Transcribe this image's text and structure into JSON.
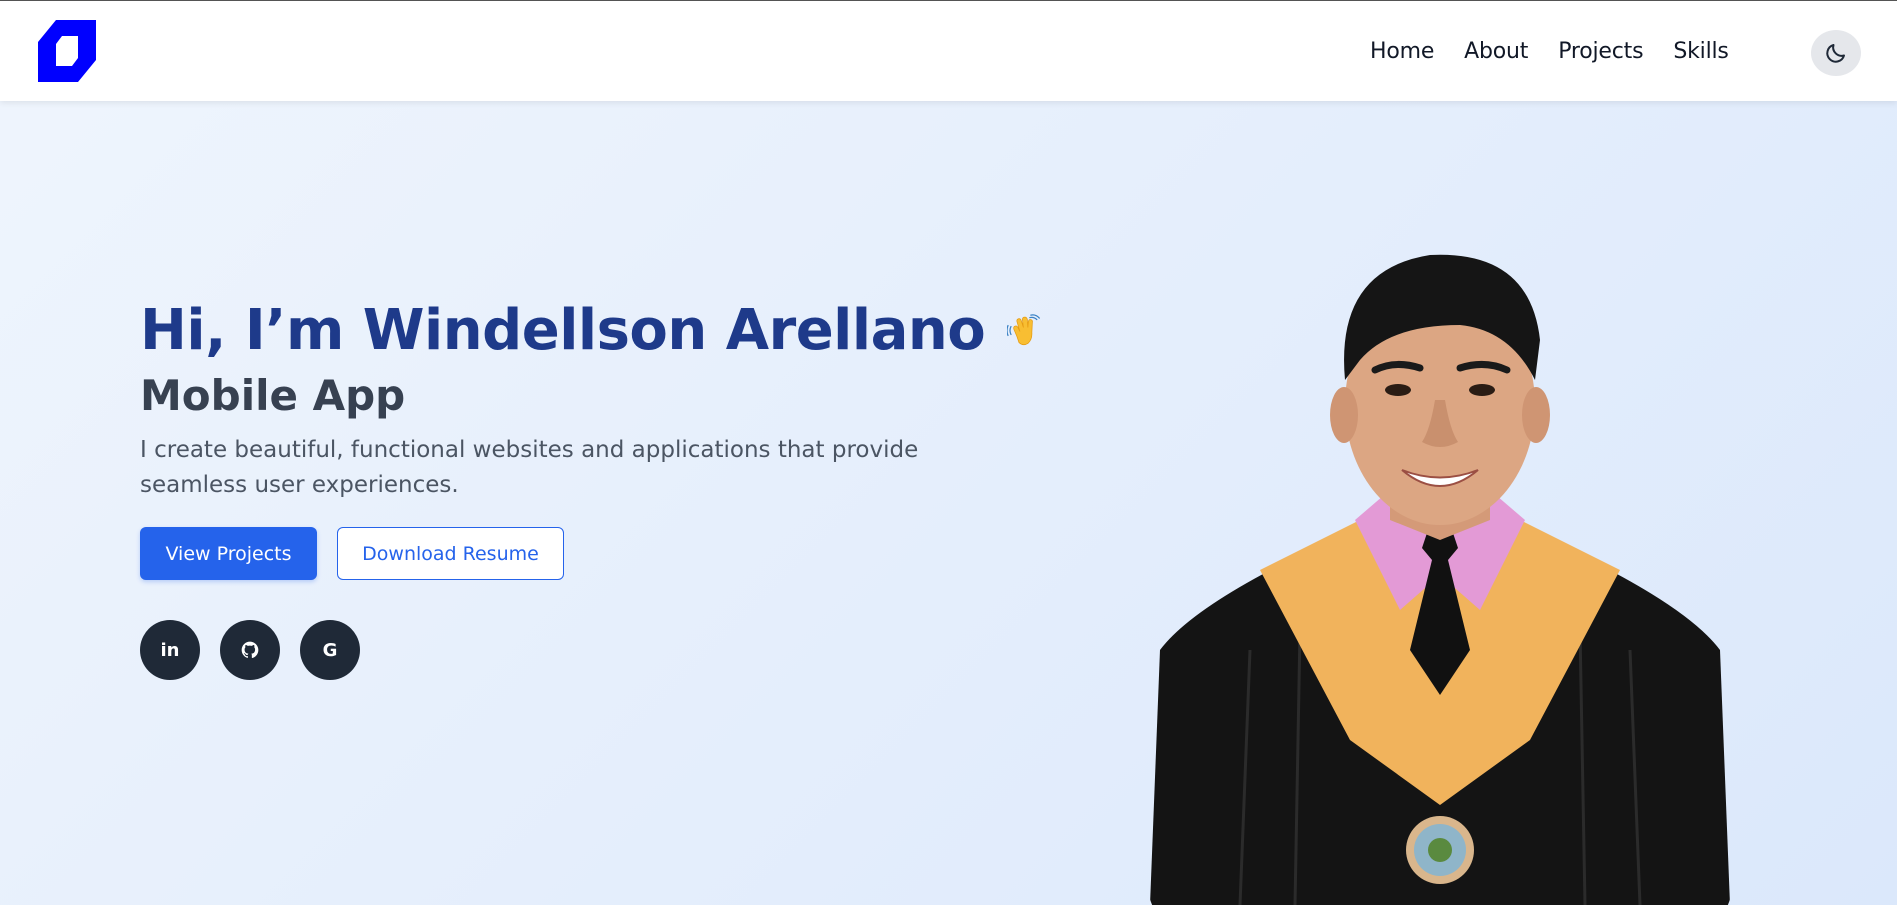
{
  "nav": {
    "items": [
      {
        "label": "Home"
      },
      {
        "label": "About"
      },
      {
        "label": "Projects"
      },
      {
        "label": "Skills"
      }
    ]
  },
  "colors": {
    "brand_blue": "#0000ff",
    "heading": "#1e3a8a",
    "primary": "#2563eb",
    "social_bg": "#1f2937"
  },
  "icons": {
    "logo": "brand-logo-icon",
    "theme_toggle": "moon-icon",
    "wave": "waving-hand-icon",
    "linkedin": "linkedin-icon",
    "github": "github-icon",
    "google": "google-icon"
  },
  "hero": {
    "heading": "Hi, I’m Windellson Arellano",
    "subtitle": "Mobile App",
    "description": "I create beautiful, functional websites and applications that provide seamless user experiences.",
    "primary_button": "View Projects",
    "secondary_button": "Download Resume",
    "social_linkedin": "in",
    "social_google": "G"
  }
}
